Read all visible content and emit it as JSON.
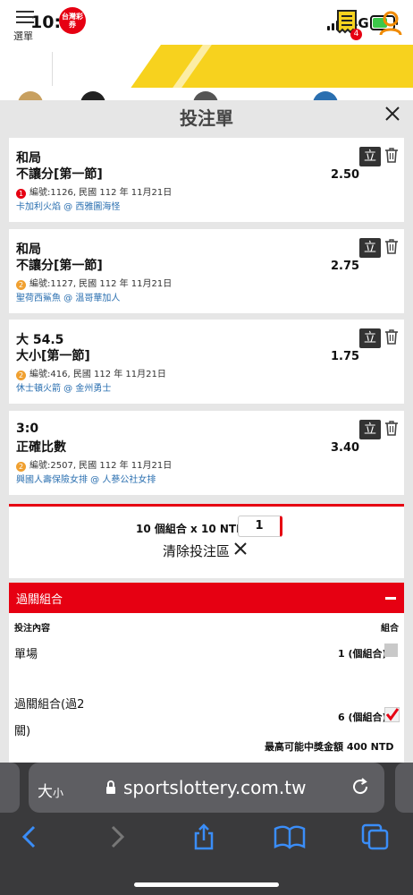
{
  "status_bar": {
    "time": "10:39",
    "network": "4G"
  },
  "header": {
    "menu_label": "選單",
    "logo_text": "台灣彩券",
    "bets_badge": "4"
  },
  "modal": {
    "title": "投注單"
  },
  "bets": [
    {
      "line1": "和局",
      "line2": "不讓分[第一節]",
      "index": "1",
      "index_color": "#e60012",
      "meta": "編號:1126, 民國 112 年 11月21日",
      "teams": "卡加利火焰 @ 西雅圖海怪",
      "odds": "2.50",
      "li_label": "立"
    },
    {
      "line1": "和局",
      "line2": "不讓分[第一節]",
      "index": "2",
      "index_color": "#f0a030",
      "meta": "編號:1127, 民國 112 年 11月21日",
      "teams": "聖荷西鯊魚 @ 溫哥華加人",
      "odds": "2.75",
      "li_label": "立"
    },
    {
      "line1": "大 54.5",
      "line2": "大小[第一節]",
      "index": "2",
      "index_color": "#f0a030",
      "meta": "編號:416, 民國 112 年 11月21日",
      "teams": "休士頓火箭 @ 金州勇士",
      "odds": "1.75",
      "li_label": "立"
    },
    {
      "line1": "3:0",
      "line2": "正確比數",
      "index": "2",
      "index_color": "#f0a030",
      "meta": "編號:2507, 民國 112 年 11月21日",
      "teams": "興國人壽保險女排 @ 人蔘公社女排",
      "odds": "3.40",
      "li_label": "立"
    }
  ],
  "stake": {
    "summary": "10 個組合 x 10 NTD x",
    "multiplier": "1",
    "clear_label": "清除投注區"
  },
  "parlay": {
    "title": "過關組合",
    "col_content": "投注內容",
    "col_combo": "組合",
    "row1_label": "單場",
    "row1_value": "1 (個組合)",
    "row2_label_a": "過關組合(過2",
    "row2_label_b": "關)",
    "row2_value": "6 (個組合)",
    "max_win": "最高可能中獎金額 400 NTD"
  },
  "safari": {
    "aa": "大",
    "aa_small": "小",
    "url": "sportslottery.com.tw"
  },
  "colors": {
    "brand_red": "#e60012",
    "brand_yellow": "#f7d21e",
    "link_blue": "#2a6fb0"
  }
}
